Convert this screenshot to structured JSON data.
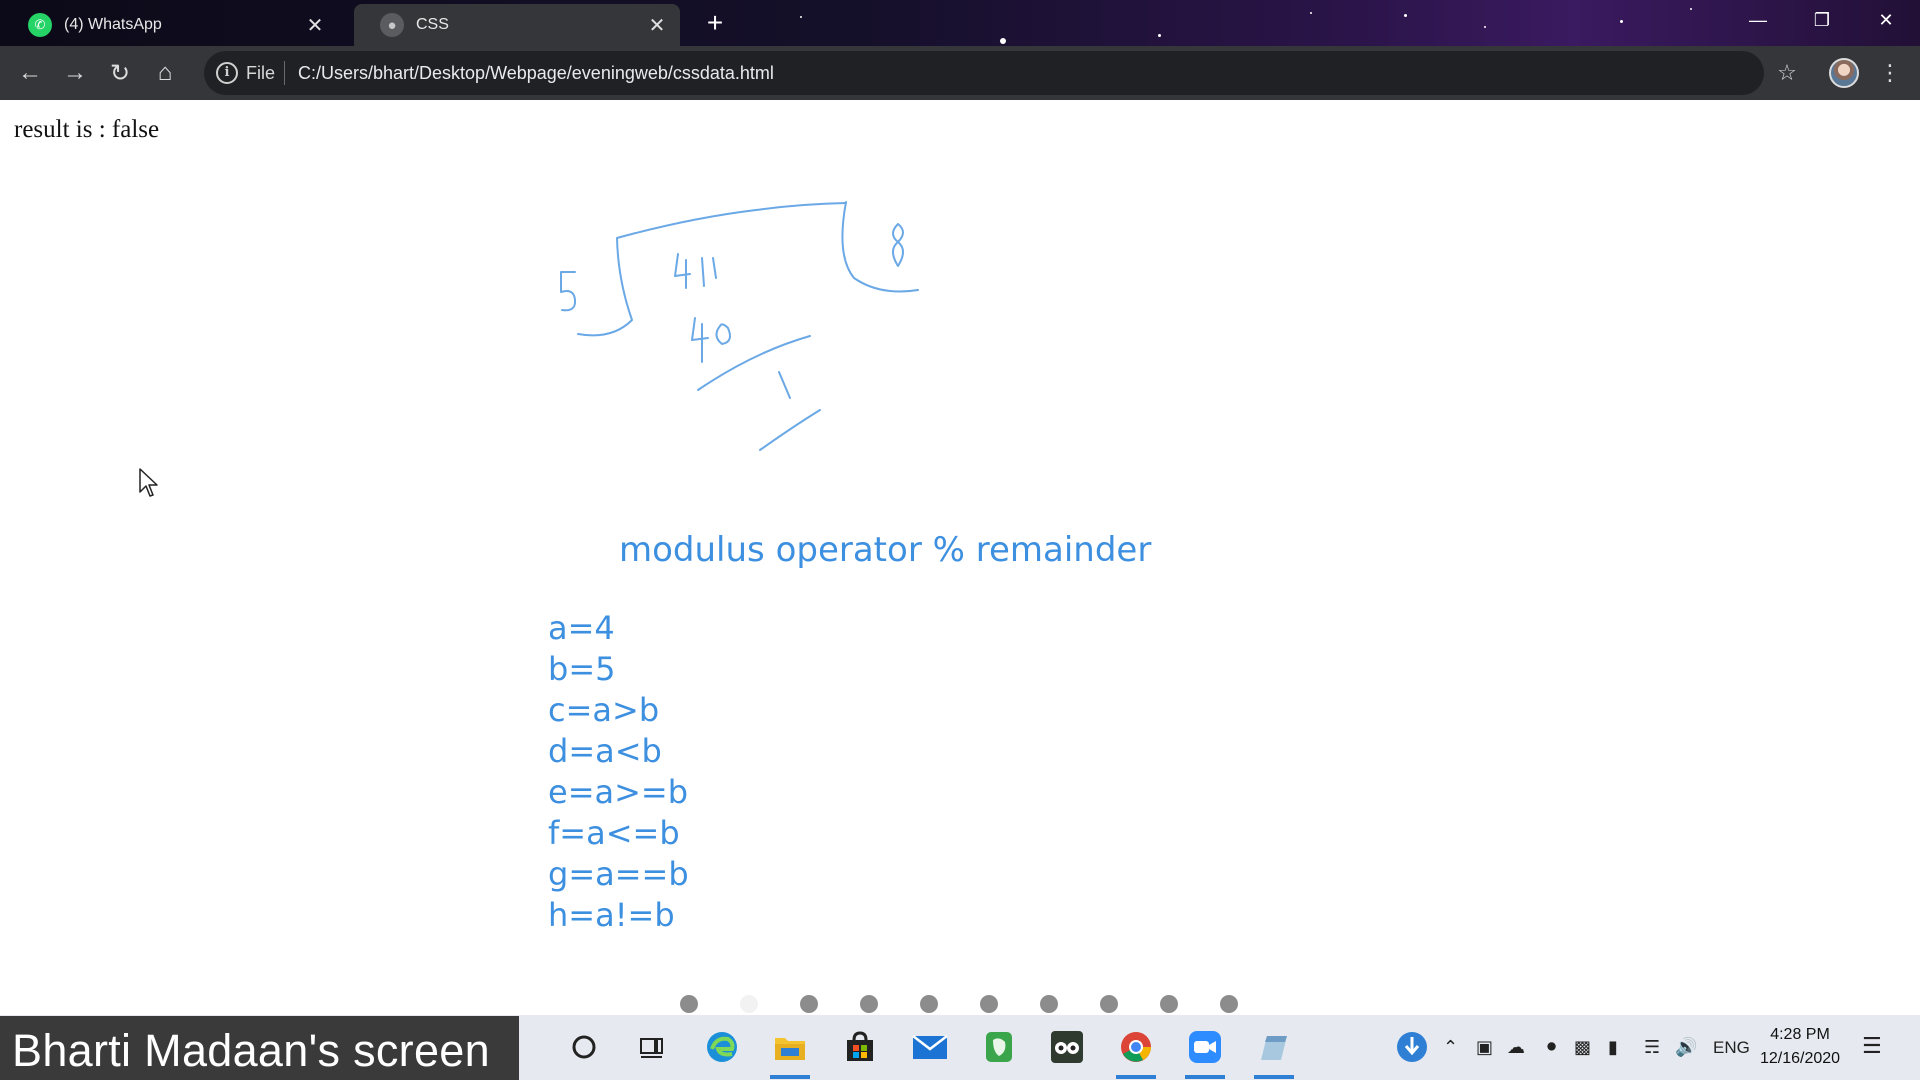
{
  "browser": {
    "tabs": [
      {
        "title": "(4) WhatsApp",
        "favicon": "whatsapp-icon"
      },
      {
        "title": "CSS",
        "favicon": "globe-icon"
      }
    ],
    "address": {
      "scheme_label": "File",
      "url": "C:/Users/bhart/Desktop/Webpage/eveningweb/cssdata.html"
    }
  },
  "page": {
    "result_text": "result is : false",
    "whiteboard": {
      "ink_color": "#6aa8e6",
      "heading": "modulus operator % remainder",
      "expressions": [
        "a=4",
        "b=5",
        "c=a>b",
        "d=a<b",
        "e=a>=b",
        "f=a<=b",
        "g=a==b",
        "h=a!=b"
      ]
    },
    "slide_dots": {
      "total": 10,
      "current": 2
    }
  },
  "taskbar": {
    "search_icon": "cortana-circle-icon",
    "apps": [
      "task-view-icon",
      "edge-icon",
      "file-explorer-icon",
      "store-icon",
      "mail-icon",
      "evernote-icon",
      "tripadvisor-icon",
      "chrome-icon",
      "zoom-icon",
      "pen-app-icon"
    ],
    "tray": {
      "language": "ENG"
    },
    "clock": {
      "time": "4:28 PM",
      "date": "12/16/2020"
    }
  },
  "screen_share": {
    "label": "Bharti Madaan's screen"
  },
  "colors": {
    "titlebar": "#15102a",
    "toolbar": "#35363a",
    "omnibox": "#202124",
    "ink": "#6aa8e6",
    "text_blue": "#3d8fe0",
    "taskbar": "#e6eaf0",
    "share_banner": "#3a3a3a"
  }
}
